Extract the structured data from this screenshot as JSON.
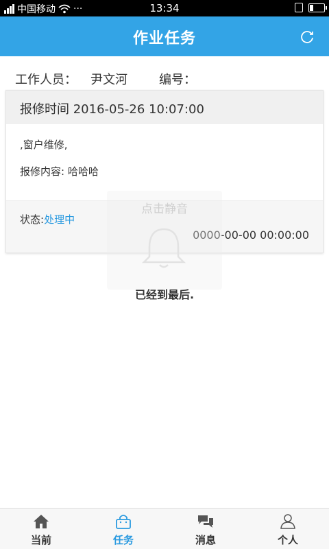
{
  "status_bar": {
    "carrier": "中国移动",
    "more": "···",
    "time": "13:34"
  },
  "header": {
    "title": "作业任务",
    "refresh_icon": "refresh-icon"
  },
  "worker": {
    "name_label": "工作人员：",
    "name": "尹文河",
    "number_label": "编号："
  },
  "task_card": {
    "report_time": "报修时间 2016-05-26 10:07:00",
    "description": ",窗户维修,",
    "content": "报修内容: 哈哈哈",
    "status_label": "状态:",
    "status_value": "处理中",
    "timestamp": "0000-00-00 00:00:00"
  },
  "mute_overlay": {
    "text": "点击静音",
    "icon": "bell-icon"
  },
  "list_end": "已经到最后.",
  "colors": {
    "header": "#33a4e6",
    "accent": "#2a9ae0"
  },
  "bottom_nav": {
    "items": [
      {
        "label": "当前",
        "icon": "home-icon"
      },
      {
        "label": "任务",
        "icon": "bag-icon",
        "active": true
      },
      {
        "label": "消息",
        "icon": "chat-icon"
      },
      {
        "label": "个人",
        "icon": "person-icon"
      }
    ]
  }
}
